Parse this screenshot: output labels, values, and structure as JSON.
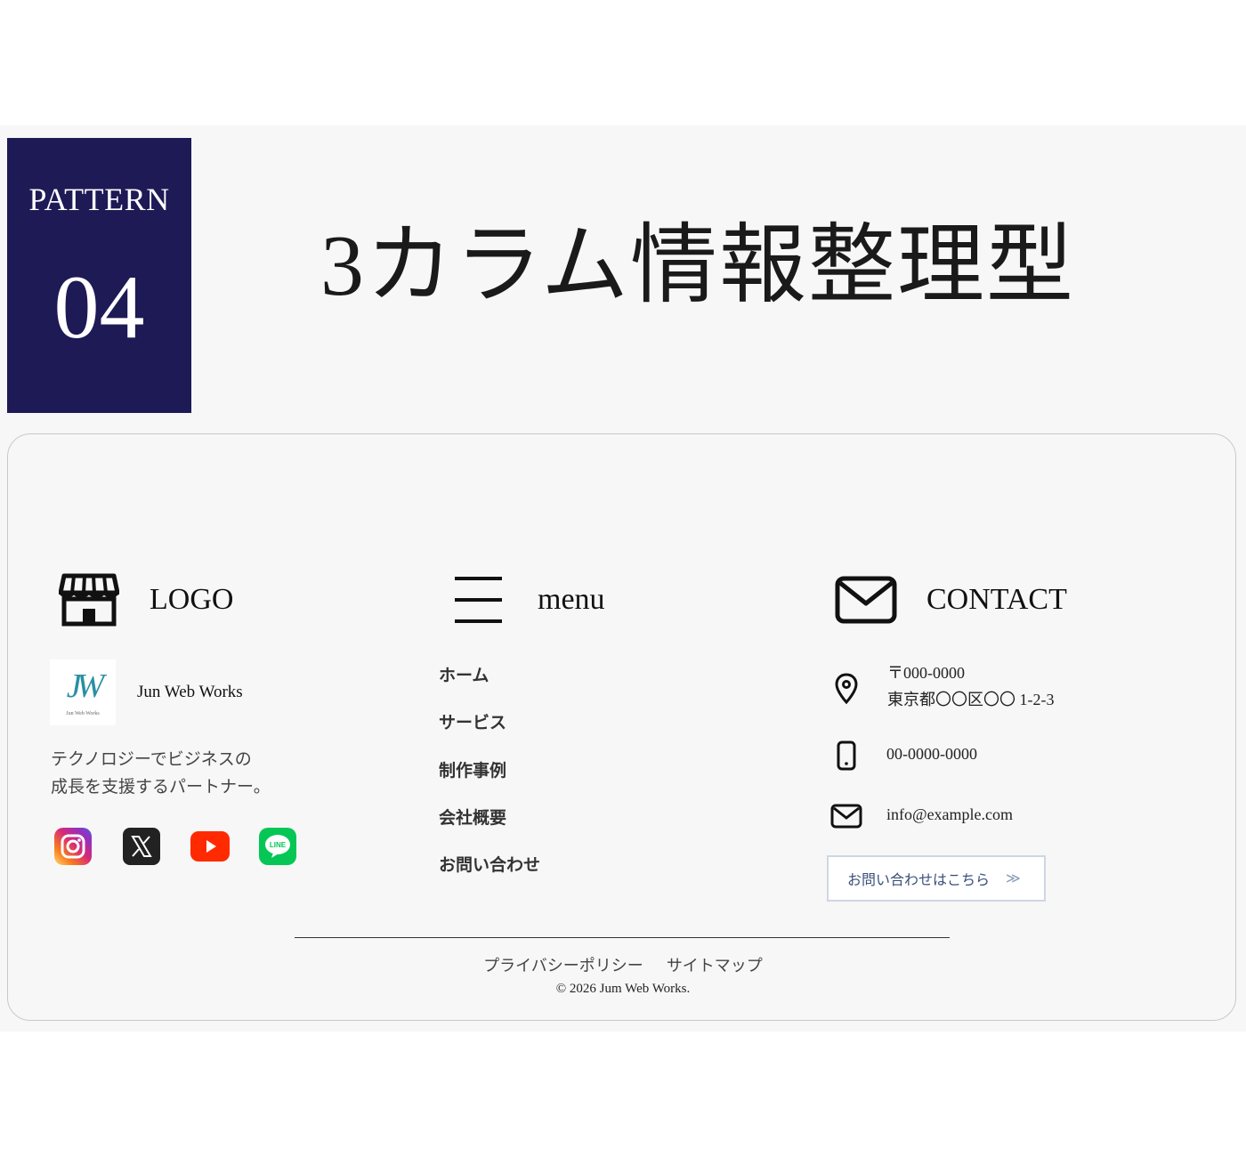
{
  "pattern": {
    "label": "PATTERN",
    "number": "04"
  },
  "title": "3カラム情報整理型",
  "columns": {
    "logo": {
      "heading": "LOGO"
    },
    "menu": {
      "heading": "menu"
    },
    "contact": {
      "heading": "CONTACT"
    }
  },
  "brand": {
    "name": "Jun Web Works",
    "logo_monogram": "JW",
    "logo_small": "Jun Web Works",
    "tagline": [
      "テクノロジーでビジネスの",
      "成長を支援するパートナー。"
    ]
  },
  "social_icons": [
    "instagram-icon",
    "x-icon",
    "youtube-icon",
    "line-icon"
  ],
  "social_labels": {
    "line": "LINE"
  },
  "menu_items": [
    "ホーム",
    "サービス",
    "制作事例",
    "会社概要",
    "お問い合わせ"
  ],
  "contact": {
    "postal": "〒000-0000",
    "address": "東京都〇〇区〇〇 1-2-3",
    "phone": "00-0000-0000",
    "email": "info@example.com",
    "cta_label": "お問い合わせはこちら",
    "cta_chevron": "≫"
  },
  "footer": {
    "privacy": "プライバシーポリシー",
    "sitemap": "サイトマップ",
    "copyright": "© 2026 Jum Web Works."
  },
  "colors": {
    "pattern_bg": "#1e1a55",
    "instagram": "#d62976",
    "x": "#222222",
    "youtube": "#ff3d00",
    "line": "#06c755"
  }
}
